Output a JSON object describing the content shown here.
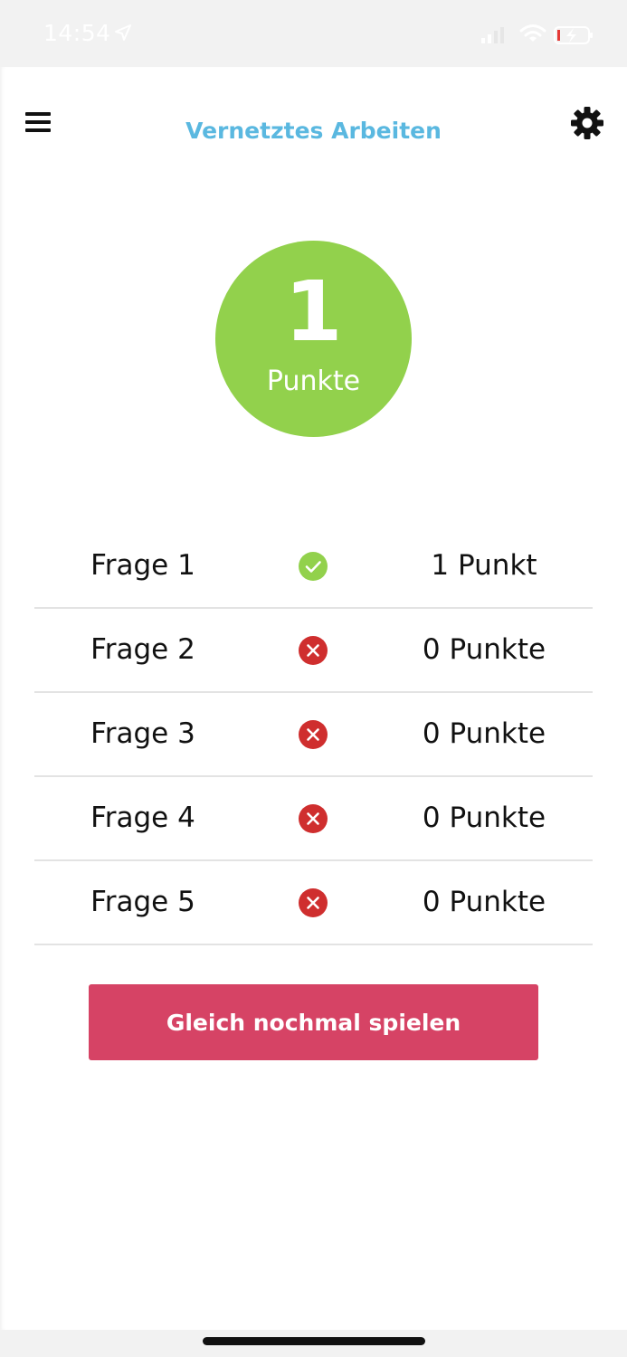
{
  "status_bar": {
    "time": "14:54",
    "icons": [
      "location-arrow-icon",
      "cellular-signal-icon",
      "wifi-icon",
      "battery-charging-icon"
    ]
  },
  "header": {
    "title": "Vernetztes Arbeiten",
    "menu_icon": "hamburger-menu-icon",
    "settings_icon": "gear-icon"
  },
  "score": {
    "value": "1",
    "unit": "Punkte",
    "color": "#92d14c"
  },
  "results": [
    {
      "question": "Frage 1",
      "status": "correct",
      "icon": "check-circle-icon",
      "points": "1 Punkt"
    },
    {
      "question": "Frage 2",
      "status": "wrong",
      "icon": "x-circle-icon",
      "points": "0 Punkte"
    },
    {
      "question": "Frage 3",
      "status": "wrong",
      "icon": "x-circle-icon",
      "points": "0 Punkte"
    },
    {
      "question": "Frage 4",
      "status": "wrong",
      "icon": "x-circle-icon",
      "points": "0 Punkte"
    },
    {
      "question": "Frage 5",
      "status": "wrong",
      "icon": "x-circle-icon",
      "points": "0 Punkte"
    }
  ],
  "actions": {
    "play_again_label": "Gleich nochmal spielen"
  },
  "colors": {
    "accent_title": "#5ab8e0",
    "correct": "#92d14c",
    "wrong": "#cf2e2e",
    "button": "#d64365"
  }
}
